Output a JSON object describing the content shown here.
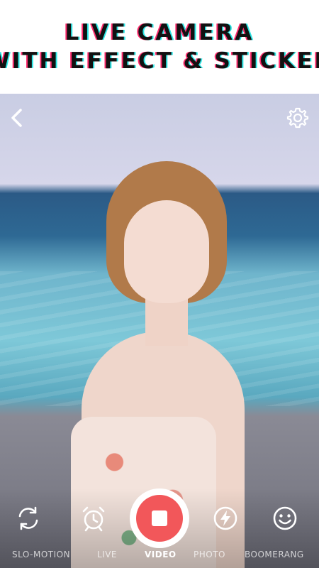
{
  "banner": {
    "line1": "LIVE CAMERA",
    "line2": "WITH EFFECT & STICKER"
  },
  "topbar": {
    "back_icon": "chevron-left-icon",
    "settings_icon": "gear-icon"
  },
  "controls": {
    "flip_icon": "camera-flip-icon",
    "timer_icon": "alarm-clock-icon",
    "shutter_icon": "record-stop-icon",
    "flash_icon": "flash-icon",
    "sticker_icon": "smiley-icon"
  },
  "modes": [
    {
      "label": "SLO-MOTION",
      "active": false
    },
    {
      "label": "LIVE",
      "active": false
    },
    {
      "label": "VIDEO",
      "active": true
    },
    {
      "label": "PHOTO",
      "active": false
    },
    {
      "label": "BOOMERANG",
      "active": false
    }
  ],
  "colors": {
    "shutter_accent": "#f2575a",
    "banner_text": "#111111",
    "glitch_red": "#ff2d6f",
    "glitch_cyan": "#2ee6e6"
  }
}
